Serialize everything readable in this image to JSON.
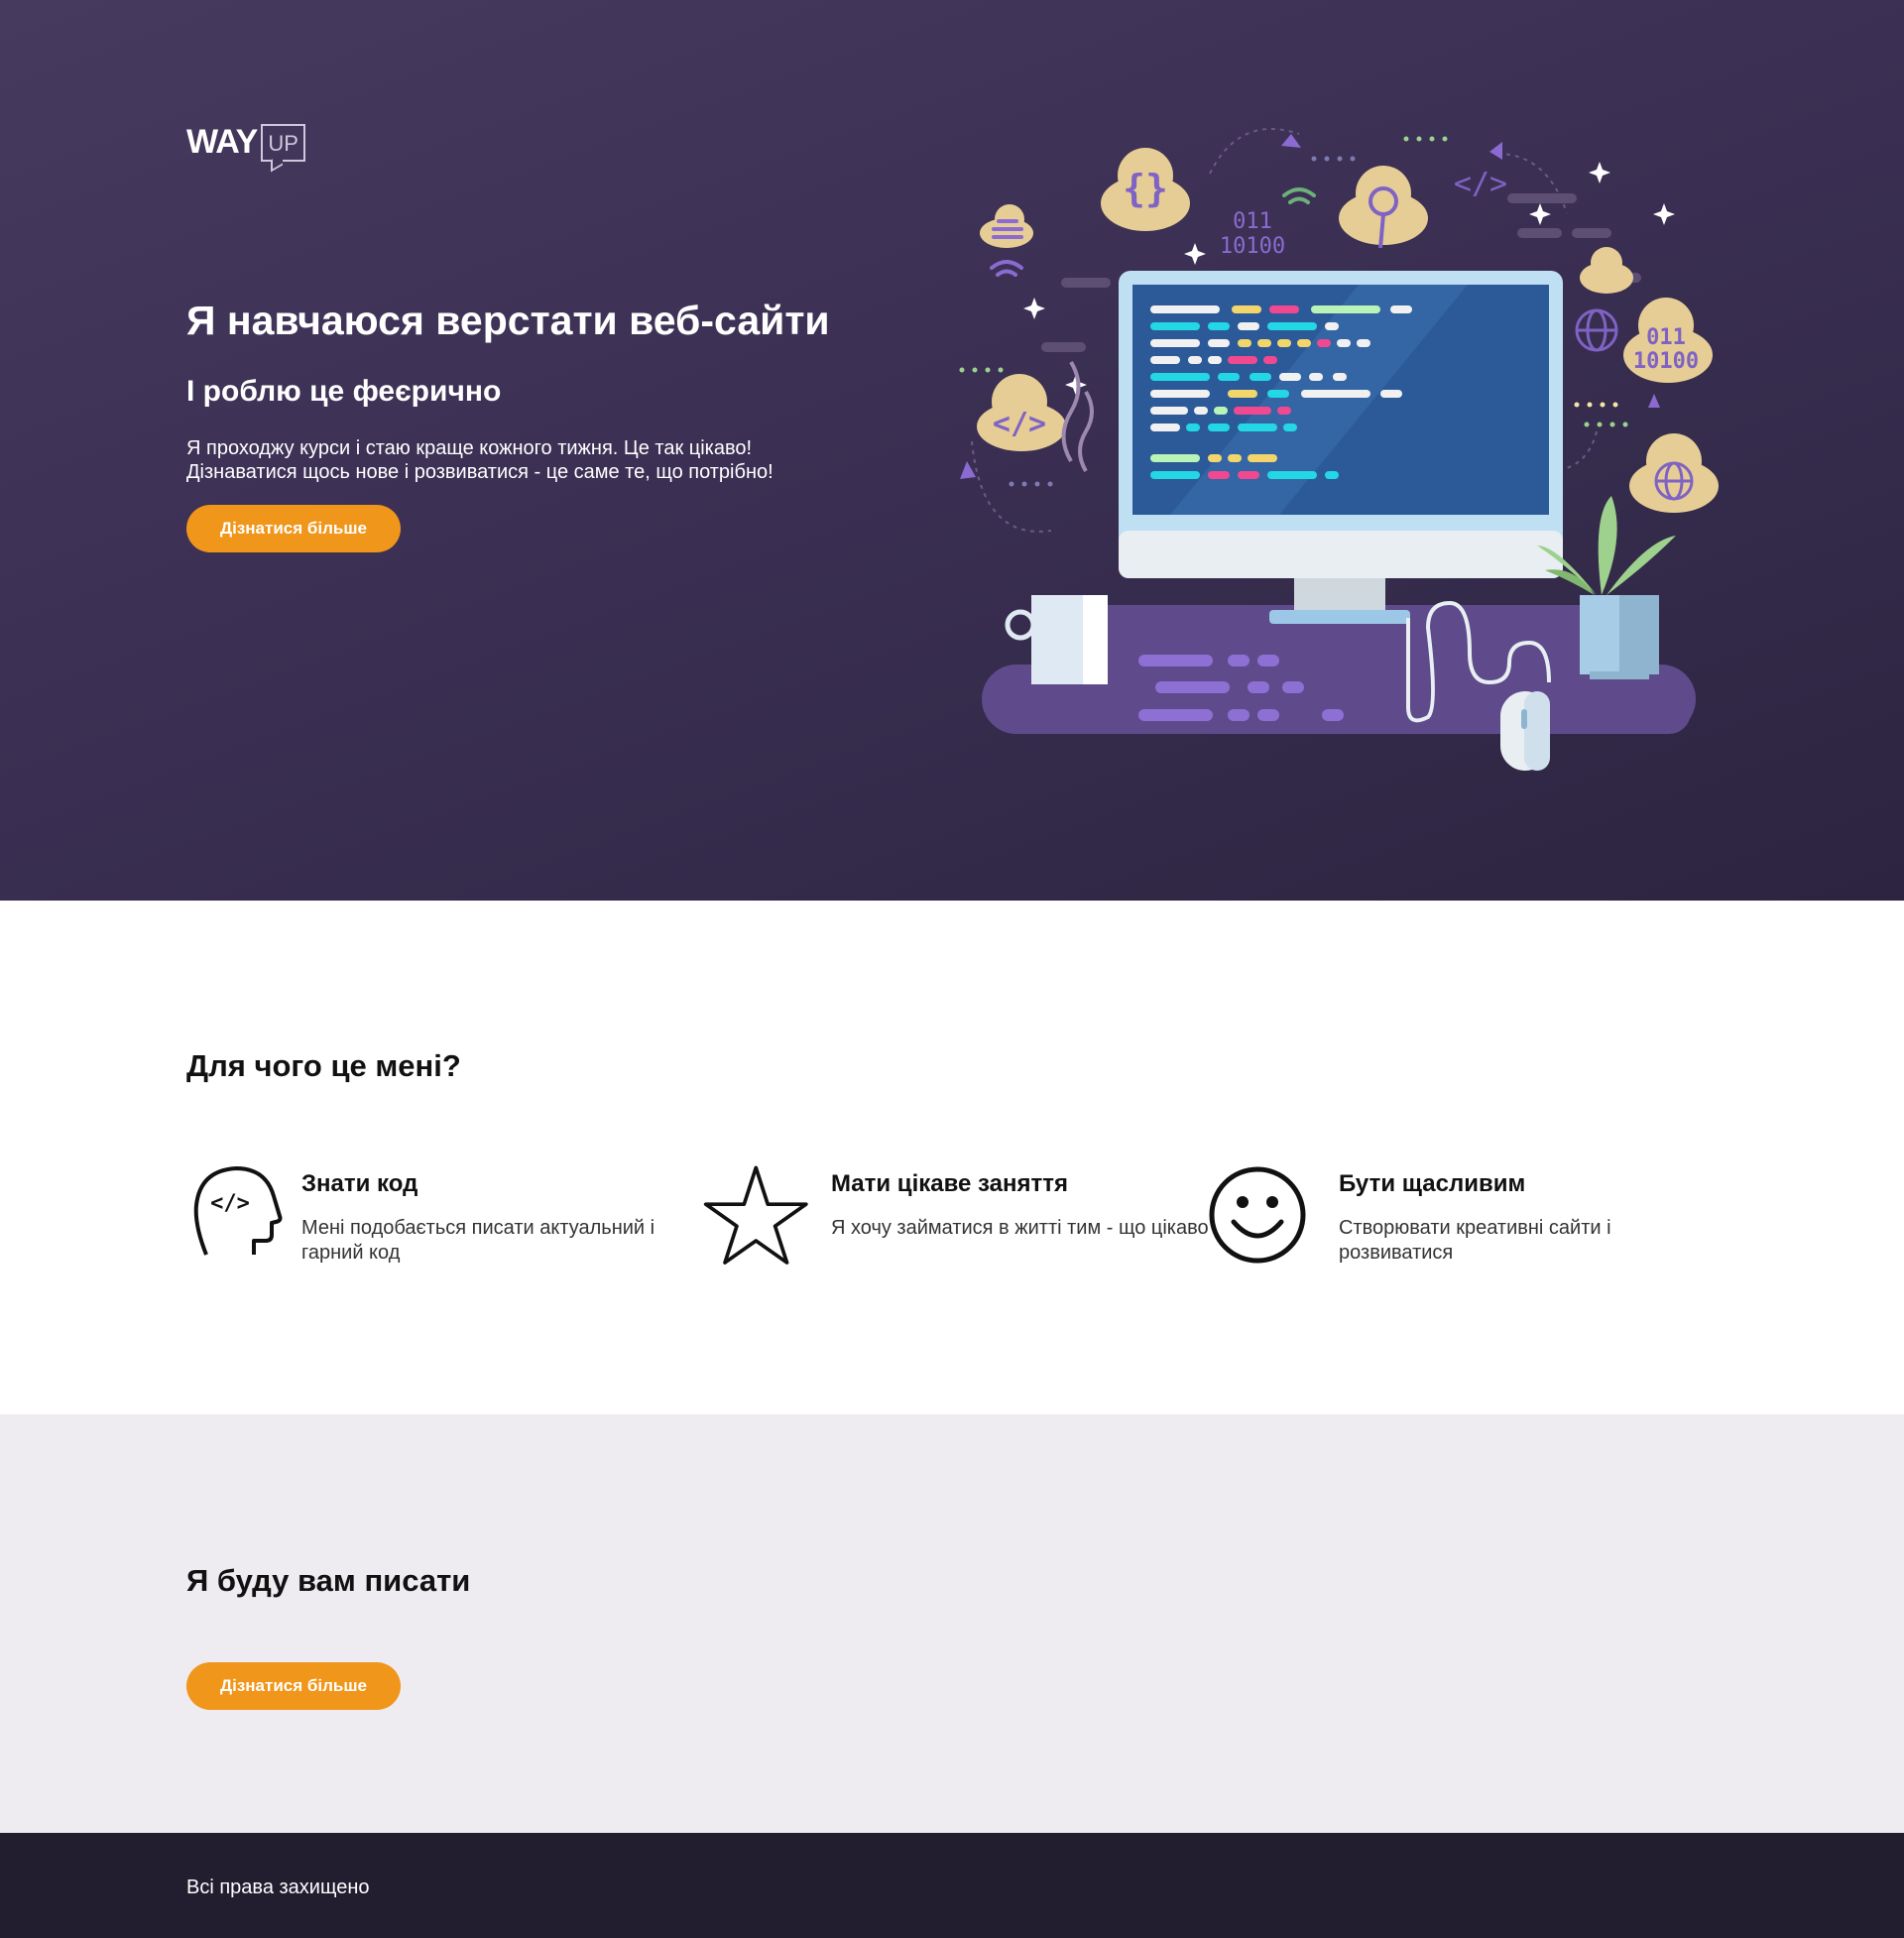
{
  "header": {
    "logo_main": "WAY",
    "logo_badge": "UP"
  },
  "hero": {
    "title": "Я навчаюся верстати веб-сайти",
    "subtitle": "І роблю це феєрично",
    "text_line1": "Я проходжу курси і стаю краще кожного тижня. Це так цікаво!",
    "text_line2": "Дізнаватися щось нове і розвиватися - це саме те, що потрібно!",
    "button_label": "Дізнатися більше",
    "illustration": {
      "code_1": "011",
      "code_2": "10100"
    }
  },
  "why": {
    "title": "Для чого це мені?",
    "features": [
      {
        "icon": "head-code-icon",
        "title": "Знати код",
        "text": "Мені подобається писати актуальний і гарний код"
      },
      {
        "icon": "star-icon",
        "title": "Мати цікаве заняття",
        "text": "Я хочу займатися в житті тим - що цікаво"
      },
      {
        "icon": "smiley-icon",
        "title": "Бути щасливим",
        "text": "Створювати креативні сайти і розвиватися"
      }
    ]
  },
  "write": {
    "title": "Я буду вам писати",
    "button_label": "Дізнатися більше"
  },
  "footer": {
    "text": "Всі права захищено"
  },
  "colors": {
    "hero_bg": "#3a2f52",
    "accent": "#f0961a",
    "section_bg": "#eeebf1",
    "footer_bg": "#221e30"
  }
}
